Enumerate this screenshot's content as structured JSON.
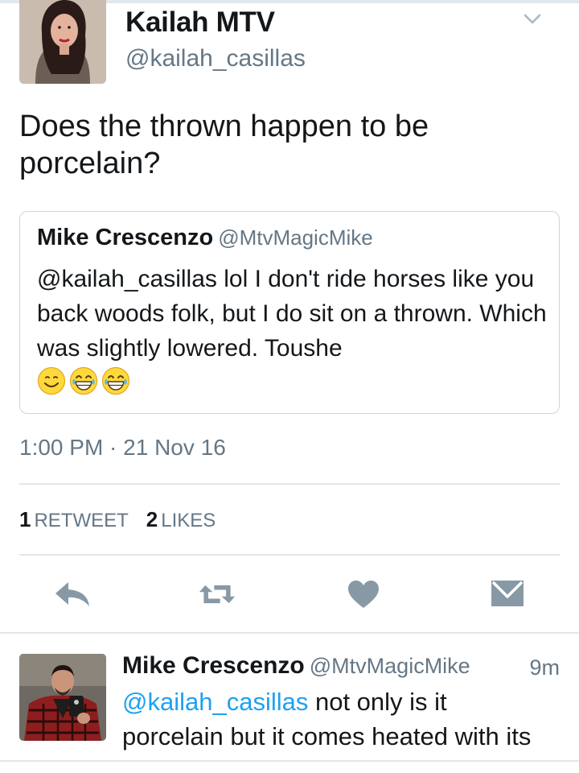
{
  "tweet": {
    "author_name": "Kailah MTV",
    "author_handle": "@kailah_casillas",
    "text": "Does the thrown happen to be porcelain?",
    "quoted": {
      "name": "Mike Crescenzo",
      "handle": "@MtvMagicMike",
      "text": "@kailah_casillas lol I don't ride horses like you back woods folk, but I do sit on a thrown. Which was slightly lowered. Toushe",
      "emojis": [
        "smiling-face-icon",
        "tears-of-joy-icon",
        "tears-of-joy-icon"
      ]
    },
    "timestamp": "1:00 PM · 21 Nov 16",
    "stats": {
      "retweets_count": "1",
      "retweets_label": "RETWEET",
      "likes_count": "2",
      "likes_label": "LIKES"
    }
  },
  "actions": [
    "reply-icon",
    "retweet-icon",
    "like-heart-icon",
    "direct-message-icon"
  ],
  "reply": {
    "author_name": "Mike Crescenzo",
    "author_handle": "@MtvMagicMike",
    "time": "9m",
    "mention": "@kailah_casillas",
    "text_part1": " not only is it",
    "text_line2": "porcelain but it comes heated with its"
  },
  "colors": {
    "text": "#14171a",
    "secondary_text": "#657786",
    "link": "#1da1f2",
    "icon": "#8899a6",
    "divider": "#e1e8ed"
  }
}
